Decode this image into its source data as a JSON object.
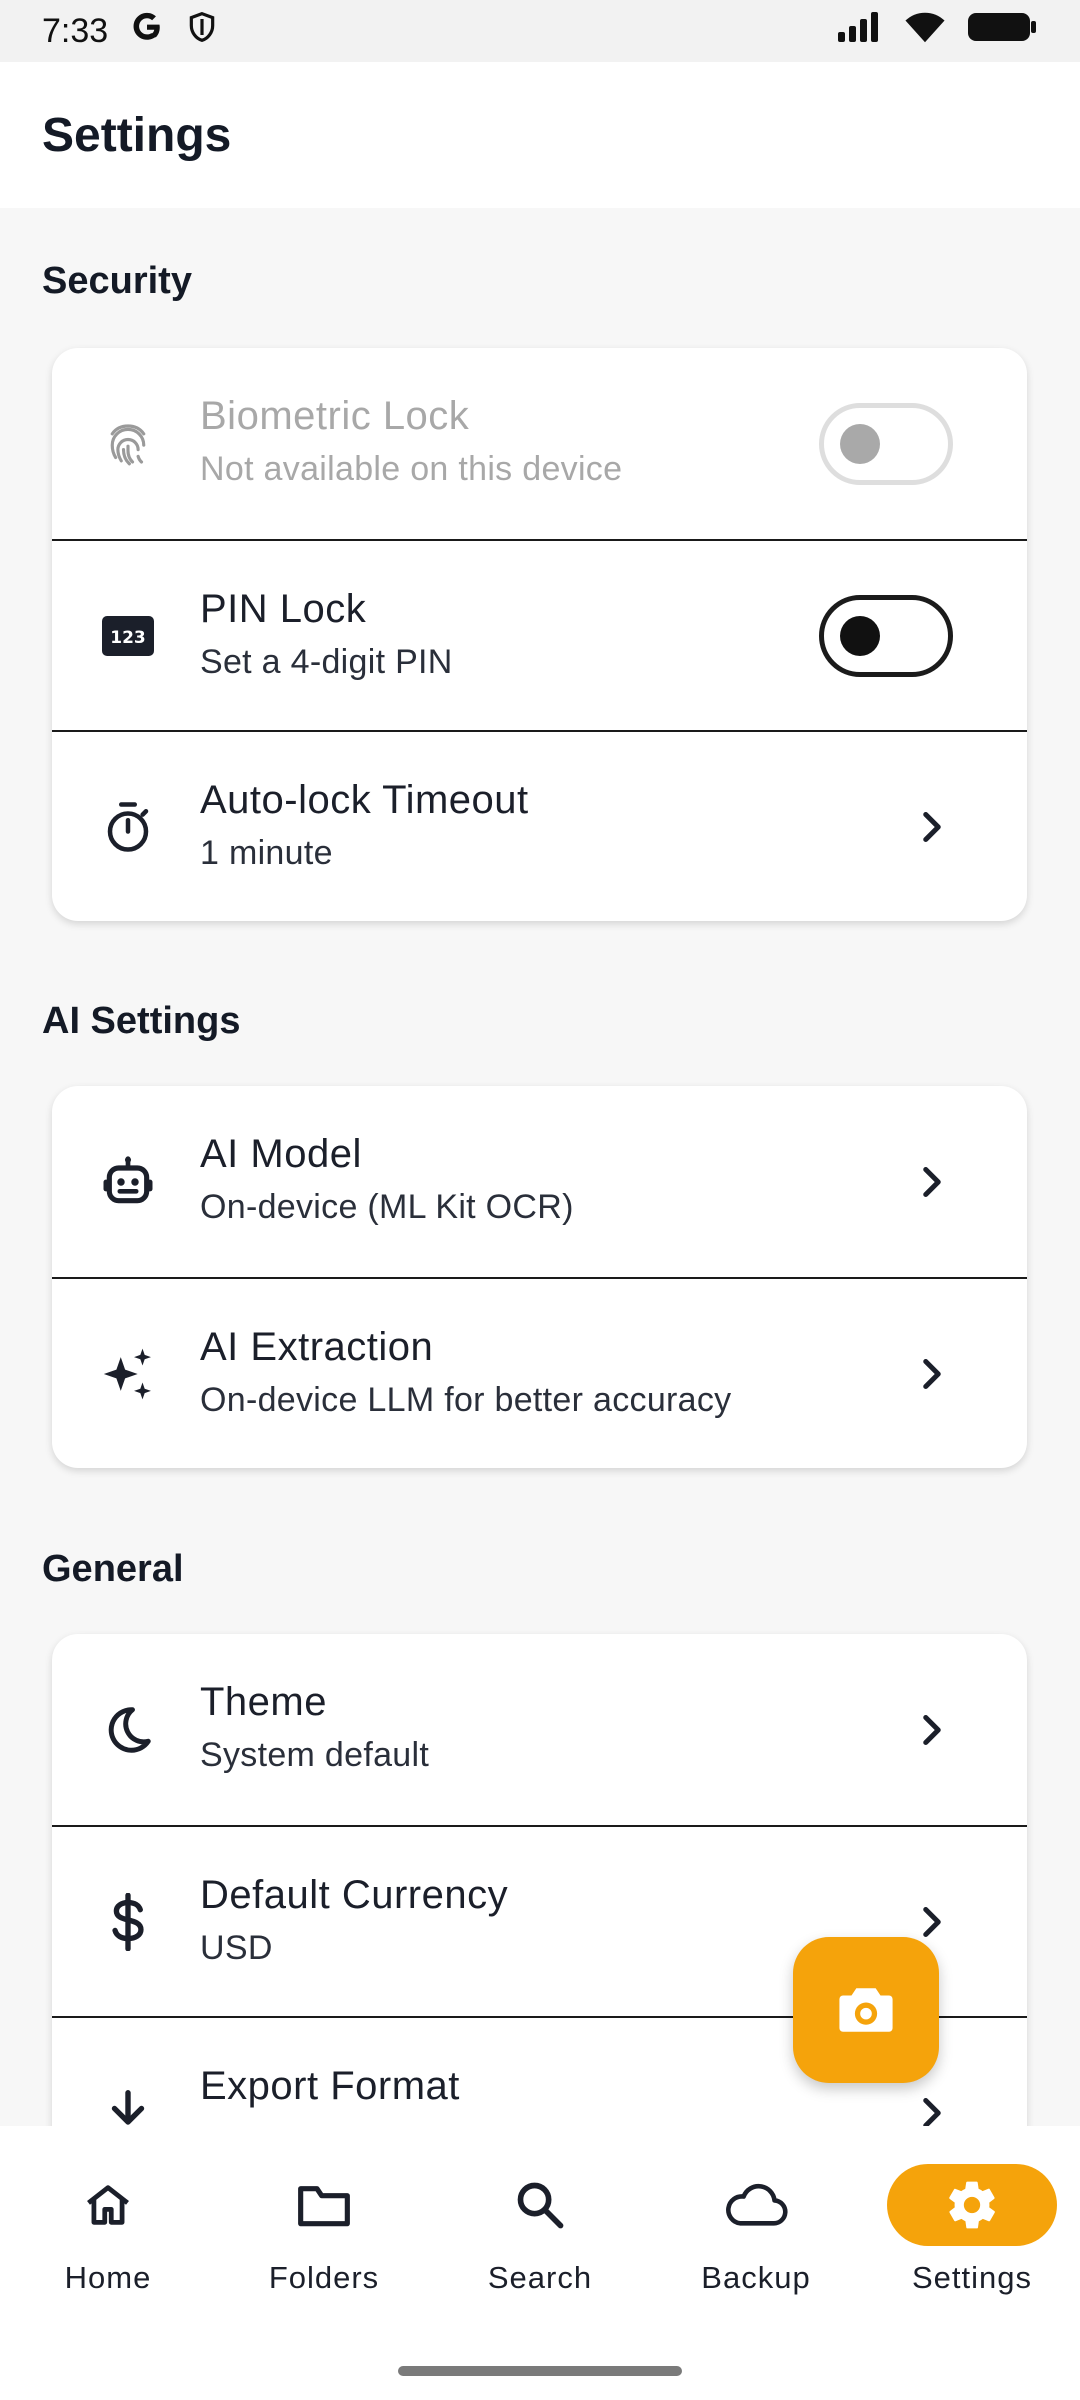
{
  "status": {
    "time": "7:33",
    "left_icons": [
      "google-icon",
      "shield-icon"
    ],
    "right_icons": [
      "signal-icon",
      "wifi-icon",
      "battery-icon"
    ]
  },
  "header": {
    "title": "Settings"
  },
  "sections": {
    "security": {
      "title": "Security",
      "biometric": {
        "title": "Biometric Lock",
        "subtitle": "Not available on this device",
        "enabled": false,
        "icon": "fingerprint-icon"
      },
      "pin": {
        "title": "PIN Lock",
        "subtitle": "Set a 4-digit PIN",
        "enabled": false,
        "icon": "pin-icon",
        "badge": "123"
      },
      "autolock": {
        "title": "Auto-lock Timeout",
        "subtitle": "1 minute",
        "icon": "timer-icon"
      }
    },
    "ai": {
      "title": "AI Settings",
      "model": {
        "title": "AI Model",
        "subtitle": "On-device (ML Kit OCR)",
        "icon": "robot-icon"
      },
      "extraction": {
        "title": "AI Extraction",
        "subtitle": "On-device LLM for better accuracy",
        "icon": "sparkle-icon"
      }
    },
    "general": {
      "title": "General",
      "theme": {
        "title": "Theme",
        "subtitle": "System default",
        "icon": "moon-icon"
      },
      "currency": {
        "title": "Default Currency",
        "subtitle": "USD",
        "icon": "dollar-icon"
      },
      "export": {
        "title": "Export Format",
        "subtitle": "",
        "icon": "download-icon"
      }
    }
  },
  "fab": {
    "icon": "camera-icon"
  },
  "nav": {
    "items": [
      {
        "label": "Home",
        "icon": "home-icon",
        "active": false
      },
      {
        "label": "Folders",
        "icon": "folder-icon",
        "active": false
      },
      {
        "label": "Search",
        "icon": "search-icon",
        "active": false
      },
      {
        "label": "Backup",
        "icon": "cloud-icon",
        "active": false
      },
      {
        "label": "Settings",
        "icon": "gear-icon",
        "active": true
      }
    ]
  },
  "colors": {
    "accent": "#f5a30b",
    "background": "#f7f7f7",
    "card": "#ffffff",
    "text": "#1b1f2a",
    "disabled": "#a8a8a8"
  }
}
